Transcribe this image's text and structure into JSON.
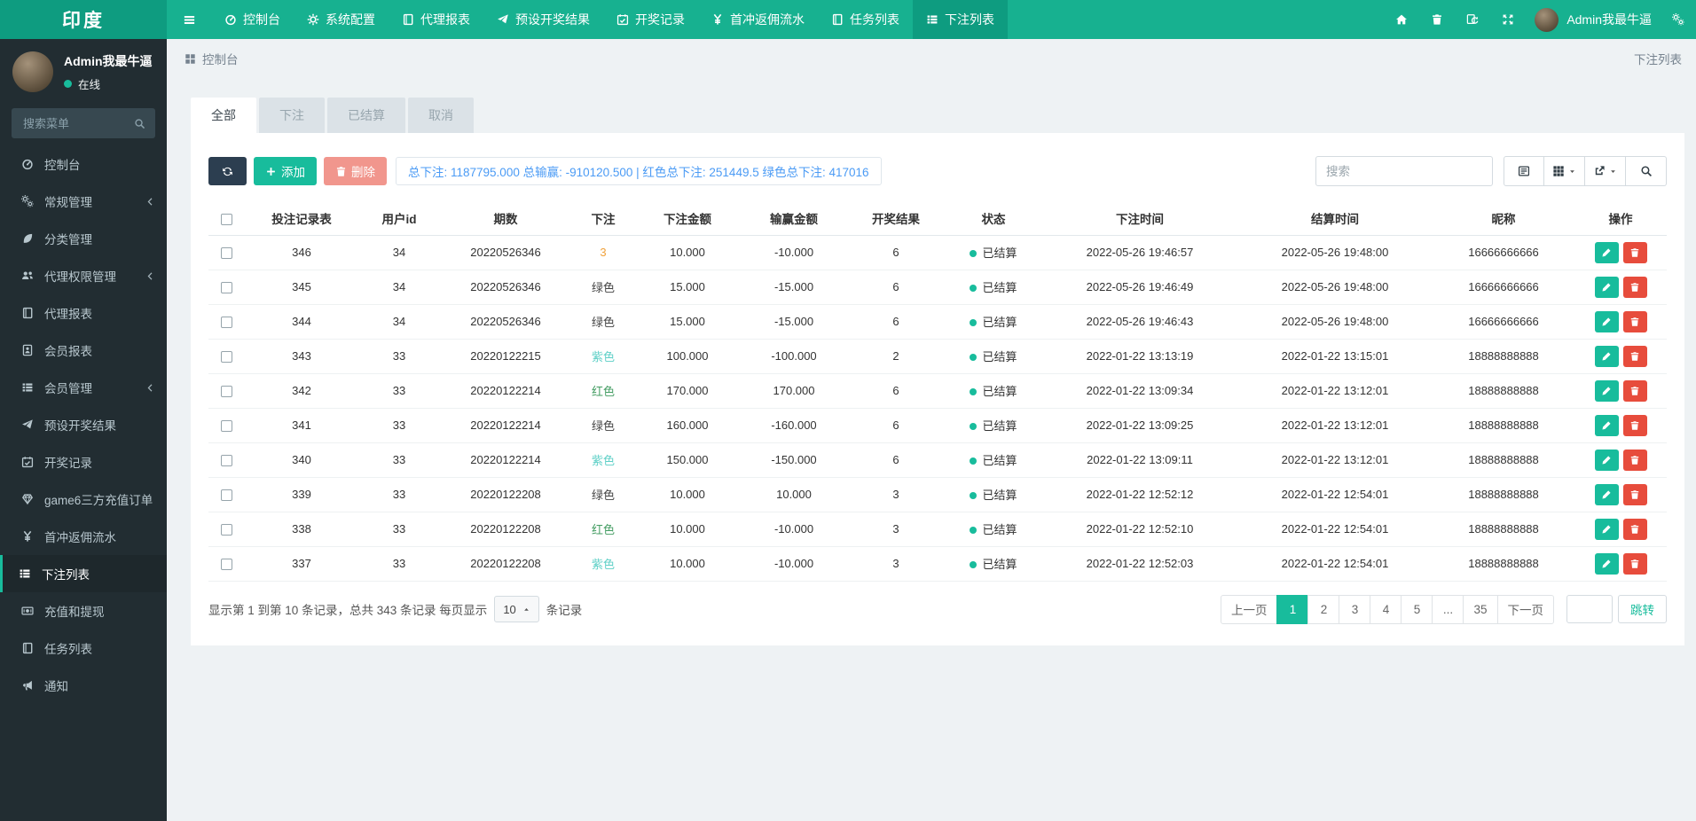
{
  "navbar": {
    "logo": "印度",
    "menu": [
      {
        "label": "控制台",
        "icon": "tachometer"
      },
      {
        "label": "系统配置",
        "icon": "gear"
      },
      {
        "label": "代理报表",
        "icon": "book"
      },
      {
        "label": "预设开奖结果",
        "icon": "send"
      },
      {
        "label": "开奖记录",
        "icon": "calendar-check"
      },
      {
        "label": "首冲返佣流水",
        "icon": "yen"
      },
      {
        "label": "任务列表",
        "icon": "book"
      },
      {
        "label": "下注列表",
        "icon": "list",
        "active": true
      }
    ],
    "right_buttons": [
      {
        "icon": "home"
      },
      {
        "icon": "trash"
      },
      {
        "icon": "clear-cache"
      },
      {
        "icon": "expand"
      }
    ],
    "user_name": "Admin我最牛逼"
  },
  "sidebar": {
    "profile": {
      "name": "Admin我最牛逼",
      "status": "在线"
    },
    "search_placeholder": "搜索菜单",
    "items": [
      {
        "label": "控制台",
        "icon": "tachometer"
      },
      {
        "label": "常规管理",
        "icon": "gears",
        "chevron": true
      },
      {
        "label": "分类管理",
        "icon": "leaf"
      },
      {
        "label": "代理权限管理",
        "icon": "users",
        "chevron": true
      },
      {
        "label": "代理报表",
        "icon": "book"
      },
      {
        "label": "会员报表",
        "icon": "id-card"
      },
      {
        "label": "会员管理",
        "icon": "list",
        "chevron": true
      },
      {
        "label": "预设开奖结果",
        "icon": "send"
      },
      {
        "label": "开奖记录",
        "icon": "calendar-check"
      },
      {
        "label": "game6三方充值订单",
        "icon": "gem"
      },
      {
        "label": "首冲返佣流水",
        "icon": "yen"
      },
      {
        "label": "下注列表",
        "icon": "list",
        "active": true
      },
      {
        "label": "充值和提现",
        "icon": "money"
      },
      {
        "label": "任务列表",
        "icon": "book"
      },
      {
        "label": "通知",
        "icon": "bullhorn"
      }
    ]
  },
  "breadcrumb": {
    "left": "控制台",
    "right": "下注列表"
  },
  "tabs": [
    {
      "label": "全部",
      "active": true
    },
    {
      "label": "下注"
    },
    {
      "label": "已结算"
    },
    {
      "label": "取消"
    }
  ],
  "toolbar": {
    "add_label": "添加",
    "delete_label": "删除",
    "summary": "总下注: 1187795.000 总输赢: -910120.500 | 红色总下注: 251449.5 绿色总下注: 417016",
    "search_placeholder": "搜索"
  },
  "table": {
    "headers": [
      "投注记录表",
      "用户id",
      "期数",
      "下注",
      "下注金额",
      "输赢金额",
      "开奖结果",
      "状态",
      "下注时间",
      "结算时间",
      "昵称",
      "操作"
    ],
    "rows": [
      {
        "id": "346",
        "user_id": "34",
        "period": "20220526346",
        "bet": "3",
        "bet_color": "#f0a23c",
        "amount": "10.000",
        "win": "-10.000",
        "result": "6",
        "status": "已结算",
        "bet_time": "2022-05-26 19:46:57",
        "settle_time": "2022-05-26 19:48:00",
        "nickname": "16666666666"
      },
      {
        "id": "345",
        "user_id": "34",
        "period": "20220526346",
        "bet": "绿色",
        "bet_color": "#444444",
        "amount": "15.000",
        "win": "-15.000",
        "result": "6",
        "status": "已结算",
        "bet_time": "2022-05-26 19:46:49",
        "settle_time": "2022-05-26 19:48:00",
        "nickname": "16666666666"
      },
      {
        "id": "344",
        "user_id": "34",
        "period": "20220526346",
        "bet": "绿色",
        "bet_color": "#444444",
        "amount": "15.000",
        "win": "-15.000",
        "result": "6",
        "status": "已结算",
        "bet_time": "2022-05-26 19:46:43",
        "settle_time": "2022-05-26 19:48:00",
        "nickname": "16666666666"
      },
      {
        "id": "343",
        "user_id": "33",
        "period": "20220122215",
        "bet": "紫色",
        "bet_color": "#5fd0c7",
        "amount": "100.000",
        "win": "-100.000",
        "result": "2",
        "status": "已结算",
        "bet_time": "2022-01-22 13:13:19",
        "settle_time": "2022-01-22 13:15:01",
        "nickname": "18888888888"
      },
      {
        "id": "342",
        "user_id": "33",
        "period": "20220122214",
        "bet": "红色",
        "bet_color": "#449d63",
        "amount": "170.000",
        "win": "170.000",
        "result": "6",
        "status": "已结算",
        "bet_time": "2022-01-22 13:09:34",
        "settle_time": "2022-01-22 13:12:01",
        "nickname": "18888888888"
      },
      {
        "id": "341",
        "user_id": "33",
        "period": "20220122214",
        "bet": "绿色",
        "bet_color": "#444444",
        "amount": "160.000",
        "win": "-160.000",
        "result": "6",
        "status": "已结算",
        "bet_time": "2022-01-22 13:09:25",
        "settle_time": "2022-01-22 13:12:01",
        "nickname": "18888888888"
      },
      {
        "id": "340",
        "user_id": "33",
        "period": "20220122214",
        "bet": "紫色",
        "bet_color": "#5fd0c7",
        "amount": "150.000",
        "win": "-150.000",
        "result": "6",
        "status": "已结算",
        "bet_time": "2022-01-22 13:09:11",
        "settle_time": "2022-01-22 13:12:01",
        "nickname": "18888888888"
      },
      {
        "id": "339",
        "user_id": "33",
        "period": "20220122208",
        "bet": "绿色",
        "bet_color": "#444444",
        "amount": "10.000",
        "win": "10.000",
        "result": "3",
        "status": "已结算",
        "bet_time": "2022-01-22 12:52:12",
        "settle_time": "2022-01-22 12:54:01",
        "nickname": "18888888888"
      },
      {
        "id": "338",
        "user_id": "33",
        "period": "20220122208",
        "bet": "红色",
        "bet_color": "#449d63",
        "amount": "10.000",
        "win": "-10.000",
        "result": "3",
        "status": "已结算",
        "bet_time": "2022-01-22 12:52:10",
        "settle_time": "2022-01-22 12:54:01",
        "nickname": "18888888888"
      },
      {
        "id": "337",
        "user_id": "33",
        "period": "20220122208",
        "bet": "紫色",
        "bet_color": "#5fd0c7",
        "amount": "10.000",
        "win": "-10.000",
        "result": "3",
        "status": "已结算",
        "bet_time": "2022-01-22 12:52:03",
        "settle_time": "2022-01-22 12:54:01",
        "nickname": "18888888888"
      }
    ]
  },
  "pagination": {
    "info_prefix": "显示第 1 到第 10 条记录，总共 343 条记录 每页显示",
    "page_size": "10",
    "info_suffix": "条记录",
    "prev": "上一页",
    "next": "下一页",
    "pages": [
      {
        "label": "1",
        "active": true
      },
      {
        "label": "2"
      },
      {
        "label": "3"
      },
      {
        "label": "4"
      },
      {
        "label": "5"
      },
      {
        "label": "..."
      },
      {
        "label": "35"
      }
    ],
    "jump_label": "跳转"
  },
  "colors": {
    "accent": "#18bc9c",
    "navbar": "#17b190",
    "navbar_dark": "#0e9c80",
    "sidebar": "#222d32",
    "summary_text": "#4b9bf5",
    "danger": "#e74c3c",
    "dark_button": "#2c3e50",
    "status_settled": "#18bc9c"
  }
}
